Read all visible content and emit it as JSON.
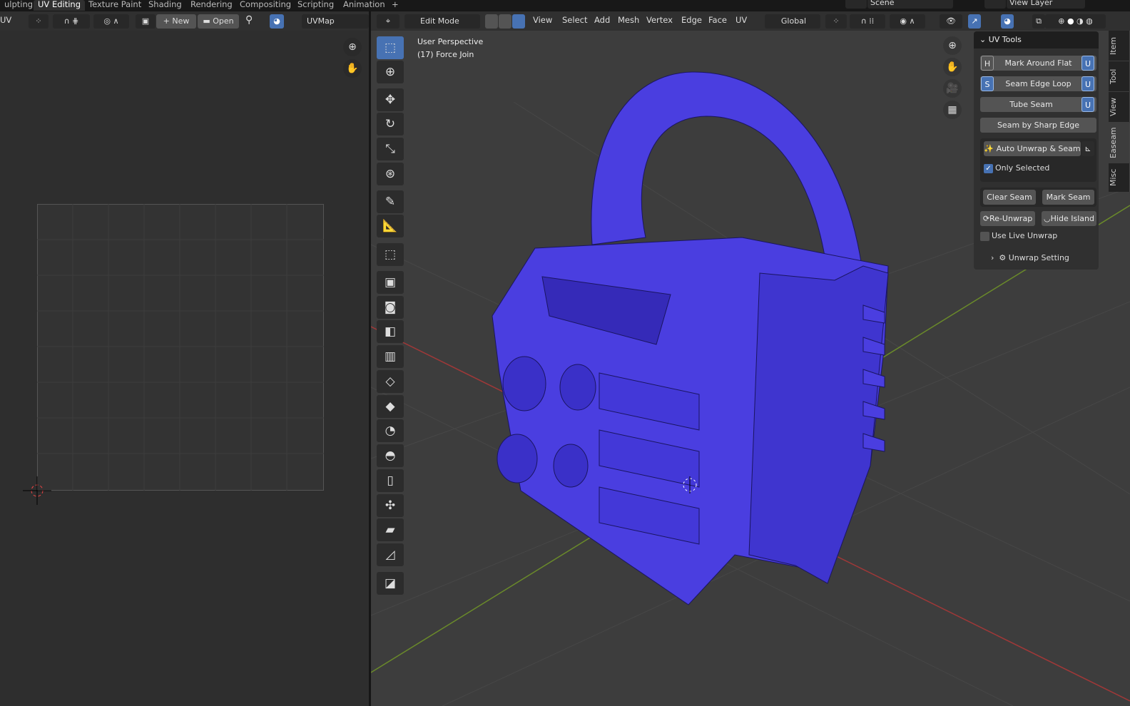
{
  "workspace_tabs": [
    "ulpting",
    "UV Editing",
    "Texture Paint",
    "Shading",
    "Rendering",
    "Compositing",
    "Scripting",
    "Animation",
    "+"
  ],
  "scene": {
    "scene_name": "Scene",
    "view_layer": "View Layer"
  },
  "uv_header": {
    "editor": "UV",
    "new": "New",
    "open": "Open",
    "uvmap": "UVMap"
  },
  "vp_header": {
    "mode": "Edit Mode",
    "menus": [
      "View",
      "Select",
      "Add",
      "Mesh",
      "Vertex",
      "Edge",
      "Face",
      "UV"
    ],
    "orientation": "Global"
  },
  "viewport": {
    "perspective": "User Perspective",
    "object": "(17) Force Join",
    "mesh_color": "#4a3ee0"
  },
  "uv_tools": {
    "title": "UV Tools",
    "mark_around_flat": "Mark Around Flat",
    "seam_edge_loop": "Seam Edge Loop",
    "tube_seam": "Tube Seam",
    "seam_by_sharp": "Seam by Sharp Edge",
    "auto_unwrap": "Auto Unwrap & Seam",
    "only_selected": "Only Selected",
    "only_selected_checked": true,
    "clear_seam": "Clear Seam",
    "mark_seam": "Mark Seam",
    "re_unwrap": "Re-Unwrap",
    "hide_island": "Hide Island",
    "use_live_unwrap": "Use Live Unwrap",
    "use_live_unwrap_checked": false,
    "unwrap_setting": "Unwrap Setting",
    "key_h": "H",
    "key_s": "S",
    "key_u": "U"
  },
  "sidebar_tabs": [
    "Item",
    "Tool",
    "View",
    "Easeam",
    "Misc"
  ]
}
